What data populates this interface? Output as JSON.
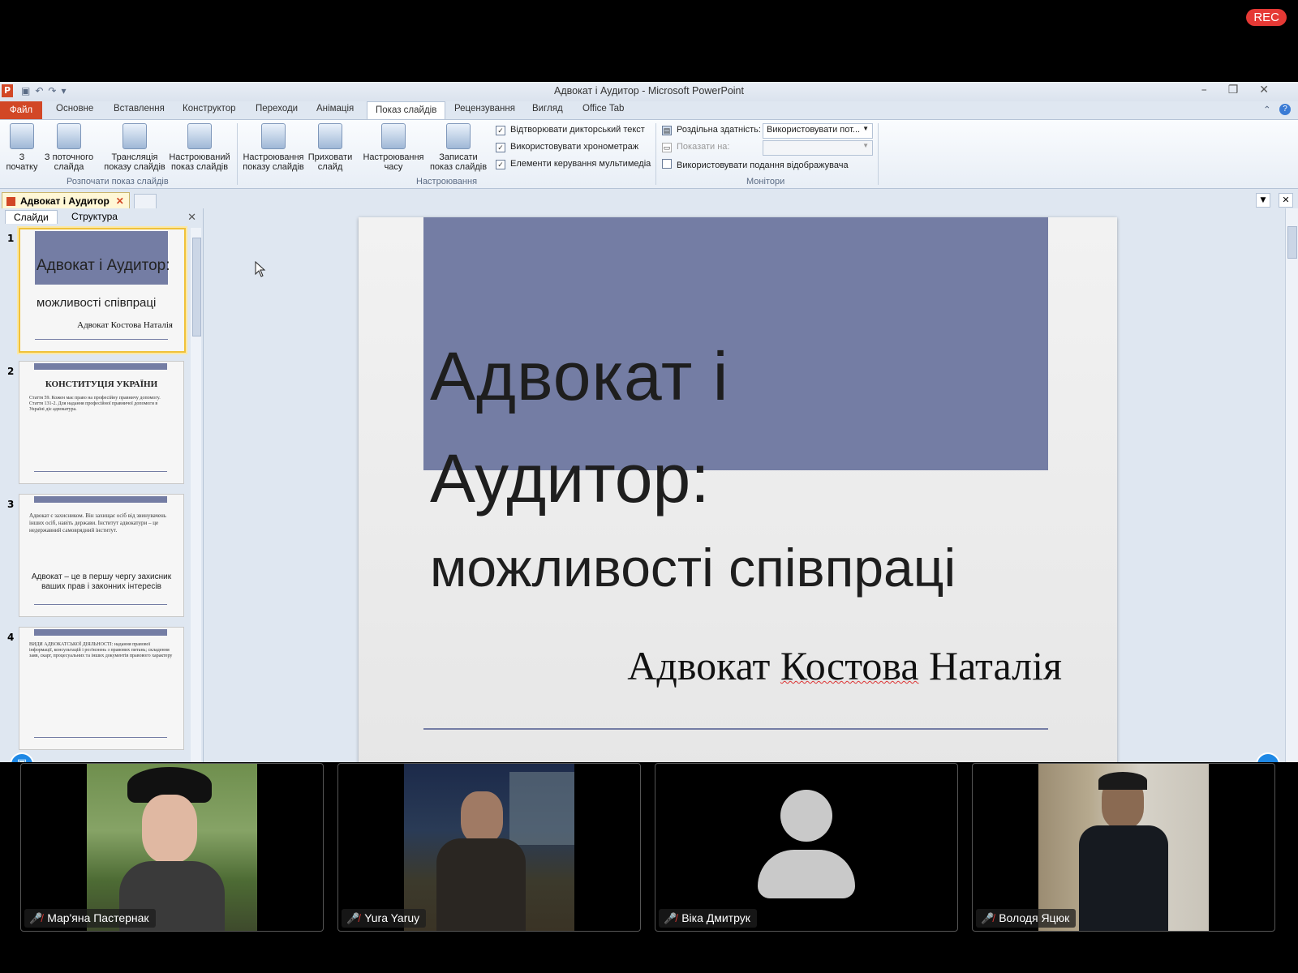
{
  "recording_badge": "REC",
  "window": {
    "title": "Адвокат і Аудитор  -  Microsoft PowerPoint",
    "app_icon": "P"
  },
  "ribbon_tabs": [
    "Файл",
    "Основне",
    "Вставлення",
    "Конструктор",
    "Переходи",
    "Анімація",
    "Показ слайдів",
    "Рецензування",
    "Вигляд",
    "Office Tab"
  ],
  "active_tab": "Показ слайдів",
  "ribbon": {
    "start_group": {
      "label": "Розпочати показ слайдів",
      "from_start": "З\nпочатку",
      "from_current": "З поточного\nслайда",
      "broadcast": "Трансляція\nпоказу слайдів",
      "custom": "Настроюваний\nпоказ слайдів"
    },
    "setup_group": {
      "label": "Настроювання",
      "setup_show": "Настроювання\nпоказу слайдів",
      "hide_slide": "Приховати\nслайд",
      "rehearse": "Настроювання\nчасу",
      "record": "Записати\nпоказ слайдів",
      "chk_narration": "Відтворювати дикторський текст",
      "chk_timings": "Використовувати хронометраж",
      "chk_media": "Елементи керування мультимедіа"
    },
    "monitors_group": {
      "label": "Монітори",
      "resolution_label": "Роздільна здатність:",
      "resolution_value": "Використовувати пот...",
      "show_on_label": "Показати на:",
      "presenter_view": "Використовувати подання відображувача"
    }
  },
  "doc_tab": "Адвокат і Аудитор",
  "left_pane": {
    "tab_slides": "Слайди",
    "tab_outline": "Структура",
    "thumbs": [
      {
        "num": "1",
        "title": "Адвокат і Аудитор:",
        "subtitle": "можливості співпраці",
        "author": "Адвокат Костова Наталія"
      },
      {
        "num": "2",
        "title": "КОНСТИТУЦІЯ УКРАЇНИ",
        "body": "Стаття 59. Кожен має право на професійну правничу допомогу. Стаття 131-2. Для надання професійної правничої допомоги в Україні діє адвокатура."
      },
      {
        "num": "3",
        "body": "Адвокат є захисником. Він захищає осіб від звинувачень інших осіб, навіть держави. Інститут адвокатури – це недержавний самоврядний інститут.",
        "highlight": "Адвокат – це в першу чергу захисник ваших прав і законних інтересів"
      },
      {
        "num": "4",
        "body": "ВИДИ АДВОКАТСЬКОЇ ДІЯЛЬНОСТІ: надання правової інформації, консультацій і роз'яснень з правових питань; складення заяв, скарг, процесуальних та інших документів правового характеру"
      }
    ]
  },
  "slide": {
    "title_line1": "Адвокат і",
    "title_line2": "Аудитор:",
    "subtitle": "можливості співпраці",
    "author_prefix": "Адвокат ",
    "author_surname": "Костова",
    "author_name": " Наталія"
  },
  "participants": [
    {
      "name": "Мар'яна Пастернак"
    },
    {
      "name": "Yura Yaruy"
    },
    {
      "name": "Віка Дмитрук"
    },
    {
      "name": "Володя Яцюк"
    }
  ],
  "colors": {
    "accent": "#747da4",
    "file_tab": "#d24726",
    "rec": "#e53935"
  }
}
